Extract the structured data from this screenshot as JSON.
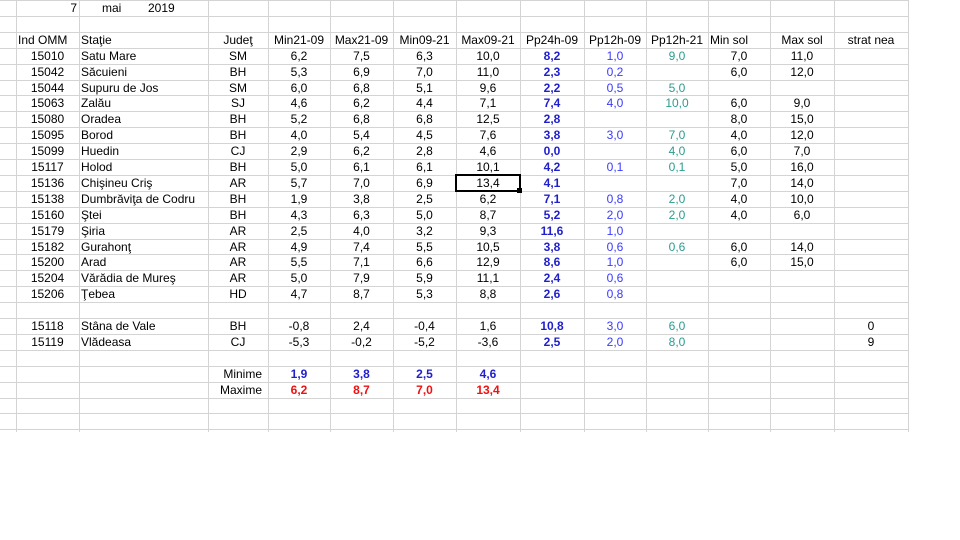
{
  "date": {
    "day": "7",
    "month": "mai",
    "year": "2019"
  },
  "headers": [
    "Ind OMM",
    "Staţie",
    "Judeţ",
    "Min21-09",
    "Max21-09",
    "Min09-21",
    "Max09-21",
    "Pp24h-09",
    "Pp12h-09",
    "Pp12h-21",
    "Min sol",
    "Max sol",
    "strat nea"
  ],
  "rows": [
    [
      "15010",
      "Satu Mare",
      "SM",
      "6,2",
      "7,5",
      "6,3",
      "10,0",
      "8,2",
      "1,0",
      "9,0",
      "7,0",
      "11,0",
      ""
    ],
    [
      "15042",
      "Săcuieni",
      "BH",
      "5,3",
      "6,9",
      "7,0",
      "11,0",
      "2,3",
      "0,2",
      "",
      "6,0",
      "12,0",
      ""
    ],
    [
      "15044",
      "Supuru de Jos",
      "SM",
      "6,0",
      "6,8",
      "5,1",
      "9,6",
      "2,2",
      "0,5",
      "5,0",
      "",
      "",
      ""
    ],
    [
      "15063",
      "Zalău",
      "SJ",
      "4,6",
      "6,2",
      "4,4",
      "7,1",
      "7,4",
      "4,0",
      "10,0",
      "6,0",
      "9,0",
      ""
    ],
    [
      "15080",
      "Oradea",
      "BH",
      "5,2",
      "6,8",
      "6,8",
      "12,5",
      "2,8",
      "",
      "",
      "8,0",
      "15,0",
      ""
    ],
    [
      "15095",
      "Borod",
      "BH",
      "4,0",
      "5,4",
      "4,5",
      "7,6",
      "3,8",
      "3,0",
      "7,0",
      "4,0",
      "12,0",
      ""
    ],
    [
      "15099",
      "Huedin",
      "CJ",
      "2,9",
      "6,2",
      "2,8",
      "4,6",
      "0,0",
      "",
      "4,0",
      "6,0",
      "7,0",
      ""
    ],
    [
      "15117",
      "Holod",
      "BH",
      "5,0",
      "6,1",
      "6,1",
      "10,1",
      "4,2",
      "0,1",
      "0,1",
      "5,0",
      "16,0",
      ""
    ],
    [
      "15136",
      "Chişineu    Criş",
      "AR",
      "5,7",
      "7,0",
      "6,9",
      "13,4",
      "4,1",
      "",
      "",
      "7,0",
      "14,0",
      ""
    ],
    [
      "15138",
      "Dumbrăviţa de Codru",
      "BH",
      "1,9",
      "3,8",
      "2,5",
      "6,2",
      "7,1",
      "0,8",
      "2,0",
      "4,0",
      "10,0",
      ""
    ],
    [
      "15160",
      "Ştei",
      "BH",
      "4,3",
      "6,3",
      "5,0",
      "8,7",
      "5,2",
      "2,0",
      "2,0",
      "4,0",
      "6,0",
      ""
    ],
    [
      "15179",
      "Şiria",
      "AR",
      "2,5",
      "4,0",
      "3,2",
      "9,3",
      "11,6",
      "1,0",
      "",
      "",
      "",
      ""
    ],
    [
      "15182",
      "Gurahonţ",
      "AR",
      "4,9",
      "7,4",
      "5,5",
      "10,5",
      "3,8",
      "0,6",
      "0,6",
      "6,0",
      "14,0",
      ""
    ],
    [
      "15200",
      "Arad",
      "AR",
      "5,5",
      "7,1",
      "6,6",
      "12,9",
      "8,6",
      "1,0",
      "",
      "6,0",
      "15,0",
      ""
    ],
    [
      "15204",
      "Vărădia de Mureş",
      "AR",
      "5,0",
      "7,9",
      "5,9",
      "11,1",
      "2,4",
      "0,6",
      "",
      "",
      "",
      ""
    ],
    [
      "15206",
      "Ţebea",
      "HD",
      "4,7",
      "8,7",
      "5,3",
      "8,8",
      "2,6",
      "0,8",
      "",
      "",
      "",
      ""
    ]
  ],
  "mountain_rows": [
    [
      "15118",
      "Stâna de Vale",
      "BH",
      "-0,8",
      "2,4",
      "-0,4",
      "1,6",
      "10,8",
      "3,0",
      "6,0",
      "",
      "",
      "0"
    ],
    [
      "15119",
      "Vlădeasa",
      "CJ",
      "-5,3",
      "-0,2",
      "-5,2",
      "-3,6",
      "2,5",
      "2,0",
      "8,0",
      "",
      "",
      "9"
    ]
  ],
  "summary": {
    "min_label": "Minime",
    "max_label": "Maxime",
    "min_values": [
      "1,9",
      "3,8",
      "2,5",
      "4,6"
    ],
    "max_values": [
      "6,2",
      "8,7",
      "7,0",
      "13,4"
    ]
  },
  "selected_cell": "15136 Max09-21",
  "colors": {
    "pp24": "#1f1fcc",
    "pp12_09": "#3a3aff",
    "pp12_21": "#2a9d8f",
    "min": "#1f1fcc",
    "max": "#ee1111",
    "grid": "#d4d4d4"
  }
}
